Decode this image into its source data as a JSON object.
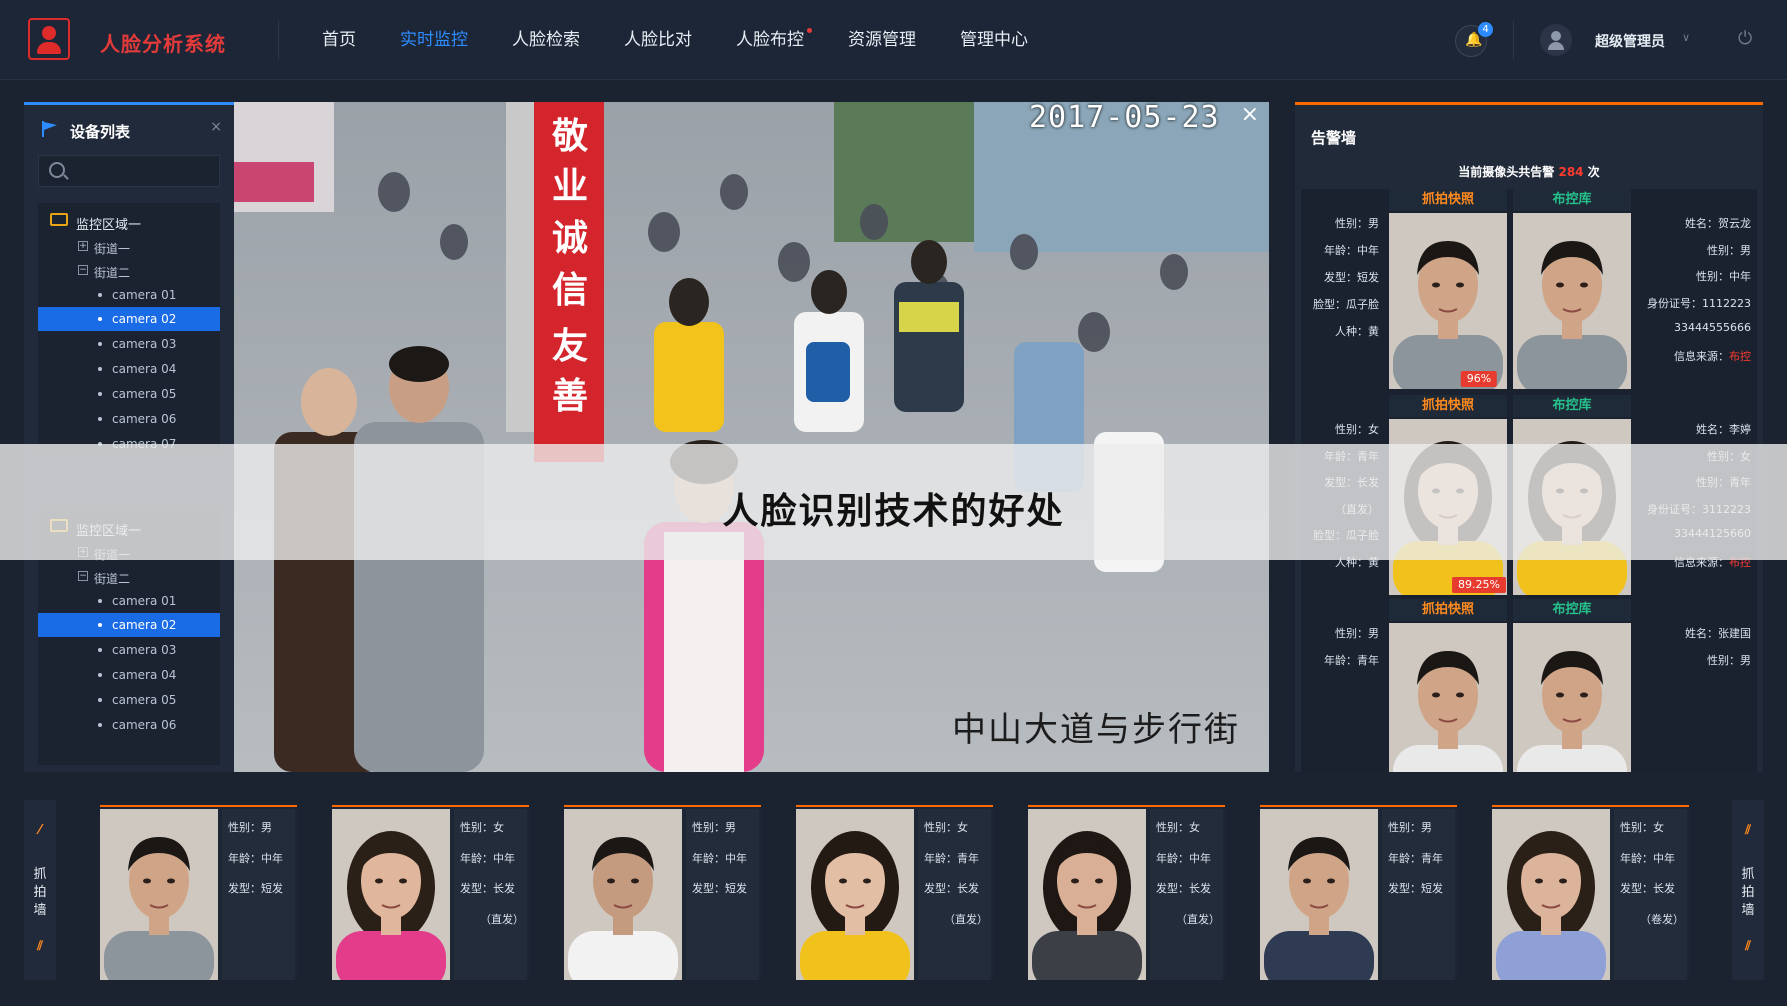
{
  "header": {
    "app_title": "人脸分析系统",
    "nav": [
      {
        "label": "首页",
        "active": false
      },
      {
        "label": "实时监控",
        "active": true
      },
      {
        "label": "人脸检索",
        "active": false
      },
      {
        "label": "人脸比对",
        "active": false
      },
      {
        "label": "人脸布控",
        "active": false,
        "dot": true
      },
      {
        "label": "资源管理",
        "active": false
      },
      {
        "label": "管理中心",
        "active": false
      }
    ],
    "notification_count": "4",
    "user_name": "超级管理员",
    "icons": [
      "logo-face-icon",
      "bell-icon",
      "user-avatar-icon",
      "caret-down-icon",
      "power-icon"
    ]
  },
  "device_list": {
    "title": "设备列表",
    "close": "×",
    "search_placeholder": "",
    "regions": [
      {
        "name": "监控区域一",
        "streets": [
          {
            "name": "街道一",
            "expanded": false,
            "toggle": "+"
          },
          {
            "name": "街道二",
            "expanded": true,
            "toggle": "−"
          }
        ],
        "cameras": [
          "camera 01",
          "camera 02",
          "camera 03",
          "camera 04",
          "camera 05",
          "camera 06",
          "camera 07"
        ],
        "selected": "camera 02"
      },
      {
        "name": "监控区域一",
        "streets": [
          {
            "name": "街道一",
            "expanded": false,
            "toggle": "+"
          },
          {
            "name": "街道二",
            "expanded": true,
            "toggle": "−"
          }
        ],
        "cameras": [
          "camera 01",
          "camera 02",
          "camera 03",
          "camera 04",
          "camera 05",
          "camera 06"
        ],
        "selected": "camera 02"
      }
    ]
  },
  "video": {
    "timestamp": "2017-05-23",
    "location": "中山大道与步行街",
    "close": "×",
    "sign_text": [
      "敬",
      "业",
      "诚",
      "信",
      "友",
      "善"
    ]
  },
  "alert_wall": {
    "title": "告警墙",
    "summary_prefix": "当前摄像头共告警",
    "summary_count": "284",
    "summary_suffix": "次",
    "capture_label": "抓拍快照",
    "control_label": "布控库",
    "cards": [
      {
        "left": [
          "性别：男",
          "年龄：中年",
          "发型：短发",
          "脸型：瓜子脸",
          "人种：黄"
        ],
        "right": [
          "姓名：贺云龙",
          "性别：男",
          "性别：中年",
          "身份证号：1112223",
          "33444555666"
        ],
        "source_label": "信息来源：",
        "source_value": "布控",
        "score": "96%"
      },
      {
        "left": [
          "性别：女",
          "年龄：青年",
          "发型：长发",
          "（直发）",
          "脸型：瓜子脸",
          "人种：黄"
        ],
        "right": [
          "姓名：李婷",
          "性别：女",
          "性别：青年",
          "身份证号：3112223",
          "33444125660"
        ],
        "source_label": "信息来源：",
        "source_value": "布控",
        "score": "89.25%"
      },
      {
        "left": [
          "性别：男",
          "年龄：青年"
        ],
        "right": [
          "姓名：张建国",
          "性别：男"
        ],
        "source_label": "",
        "source_value": "",
        "score": ""
      }
    ]
  },
  "capture_wall": {
    "label_left": "抓拍墙",
    "label_right": "抓拍墙",
    "items": [
      {
        "lines": [
          "性别：男",
          "年龄：中年",
          "发型：短发"
        ],
        "extra": ""
      },
      {
        "lines": [
          "性别：女",
          "年龄：中年",
          "发型：长发"
        ],
        "extra": "（直发）"
      },
      {
        "lines": [
          "性别：男",
          "年龄：中年",
          "发型：短发"
        ],
        "extra": ""
      },
      {
        "lines": [
          "性别：女",
          "年龄：青年",
          "发型：长发"
        ],
        "extra": "（直发）"
      },
      {
        "lines": [
          "性别：女",
          "年龄：中年",
          "发型：长发"
        ],
        "extra": "（直发）"
      },
      {
        "lines": [
          "性别：男",
          "年龄：青年",
          "发型：短发"
        ],
        "extra": ""
      },
      {
        "lines": [
          "性别：女",
          "年龄：中年",
          "发型：长发"
        ],
        "extra": "（卷发）"
      }
    ]
  },
  "overlay": {
    "text": "人脸识别技术的好处"
  },
  "colors": {
    "brand_red": "#e33a3a",
    "active_blue": "#2d8cff",
    "alert_orange": "#ff6a00",
    "control_green": "#26c18b"
  }
}
